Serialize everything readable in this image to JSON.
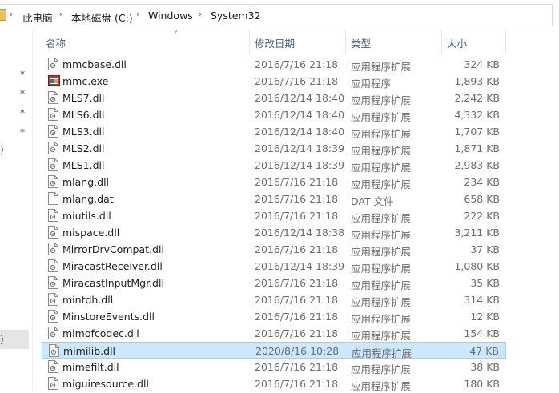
{
  "breadcrumb": {
    "items": [
      "此电脑",
      "本地磁盘 (C:)",
      "Windows",
      "System32"
    ],
    "separator": "›"
  },
  "columns": {
    "name": "名称",
    "date": "修改日期",
    "type": "类型",
    "size": "大小"
  },
  "nav_fragments": [
    ")",
    ")"
  ],
  "files": [
    {
      "name": "mmcbase.dll",
      "date": "2016/7/16 21:18",
      "type": "应用程序扩展",
      "size": "324 KB",
      "icon": "dll-file-icon"
    },
    {
      "name": "mmc.exe",
      "date": "2016/7/16 21:18",
      "type": "应用程序",
      "size": "1,893 KB",
      "icon": "mmc-app-icon"
    },
    {
      "name": "MLS7.dll",
      "date": "2016/12/14 18:40",
      "type": "应用程序扩展",
      "size": "2,242 KB",
      "icon": "dll-file-icon"
    },
    {
      "name": "MLS6.dll",
      "date": "2016/12/14 18:40",
      "type": "应用程序扩展",
      "size": "4,332 KB",
      "icon": "dll-file-icon"
    },
    {
      "name": "MLS3.dll",
      "date": "2016/12/14 18:40",
      "type": "应用程序扩展",
      "size": "1,707 KB",
      "icon": "dll-file-icon"
    },
    {
      "name": "MLS2.dll",
      "date": "2016/12/14 18:39",
      "type": "应用程序扩展",
      "size": "1,871 KB",
      "icon": "dll-file-icon"
    },
    {
      "name": "MLS1.dll",
      "date": "2016/12/14 18:39",
      "type": "应用程序扩展",
      "size": "2,983 KB",
      "icon": "dll-file-icon"
    },
    {
      "name": "mlang.dll",
      "date": "2016/7/16 21:18",
      "type": "应用程序扩展",
      "size": "234 KB",
      "icon": "dll-file-icon"
    },
    {
      "name": "mlang.dat",
      "date": "2016/7/16 21:18",
      "type": "DAT 文件",
      "size": "658 KB",
      "icon": "blank-file-icon"
    },
    {
      "name": "miutils.dll",
      "date": "2016/7/16 21:18",
      "type": "应用程序扩展",
      "size": "222 KB",
      "icon": "dll-file-icon"
    },
    {
      "name": "mispace.dll",
      "date": "2016/12/14 18:38",
      "type": "应用程序扩展",
      "size": "3,211 KB",
      "icon": "dll-file-icon"
    },
    {
      "name": "MirrorDrvCompat.dll",
      "date": "2016/7/16 21:18",
      "type": "应用程序扩展",
      "size": "37 KB",
      "icon": "dll-file-icon"
    },
    {
      "name": "MiracastReceiver.dll",
      "date": "2016/12/14 18:39",
      "type": "应用程序扩展",
      "size": "1,080 KB",
      "icon": "dll-file-icon"
    },
    {
      "name": "MiracastInputMgr.dll",
      "date": "2016/7/16 21:18",
      "type": "应用程序扩展",
      "size": "35 KB",
      "icon": "dll-file-icon"
    },
    {
      "name": "mintdh.dll",
      "date": "2016/7/16 21:18",
      "type": "应用程序扩展",
      "size": "314 KB",
      "icon": "dll-file-icon"
    },
    {
      "name": "MinstoreEvents.dll",
      "date": "2016/7/16 21:18",
      "type": "应用程序扩展",
      "size": "12 KB",
      "icon": "dll-file-icon"
    },
    {
      "name": "mimofcodec.dll",
      "date": "2016/7/16 21:18",
      "type": "应用程序扩展",
      "size": "154 KB",
      "icon": "dll-file-icon"
    },
    {
      "name": "mimilib.dll",
      "date": "2020/8/16 10:28",
      "type": "应用程序扩展",
      "size": "47 KB",
      "icon": "dll-file-icon",
      "selected": true
    },
    {
      "name": "mimefilt.dll",
      "date": "2016/7/16 21:18",
      "type": "应用程序扩展",
      "size": "38 KB",
      "icon": "dll-file-icon"
    },
    {
      "name": "miguiresource.dll",
      "date": "2016/7/16 21:18",
      "type": "应用程序扩展",
      "size": "180 KB",
      "icon": "dll-file-icon"
    }
  ],
  "colors": {
    "selection_bg": "#cce8ff",
    "selection_border": "#99d1ff",
    "header_text": "#4c607a"
  }
}
